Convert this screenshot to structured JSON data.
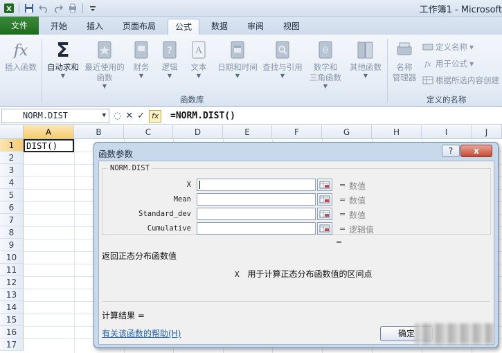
{
  "window": {
    "title": "工作簿1 - Microsoft"
  },
  "ribbon_tabs": [
    {
      "label": "文件"
    },
    {
      "label": "开始"
    },
    {
      "label": "插入"
    },
    {
      "label": "页面布局"
    },
    {
      "label": "公式"
    },
    {
      "label": "数据"
    },
    {
      "label": "审阅"
    },
    {
      "label": "视图"
    }
  ],
  "active_tab": "公式",
  "ribbon": {
    "insert_function": "插入函数",
    "autosum": "自动求和",
    "recently_used": [
      "最近使用的",
      "函数"
    ],
    "financial": "财务",
    "logical": "逻辑",
    "text": "文本",
    "datetime": "日期和时间",
    "lookup": "查找与引用",
    "math": [
      "数学和",
      "三角函数"
    ],
    "more_functions": "其他函数",
    "group_function_library": "函数库",
    "name_manager": [
      "名称",
      "管理器"
    ],
    "define_name": "定义名称",
    "use_in_formula": "用于公式",
    "create_from_selection": "根据所选内容创建",
    "group_defined_names": "定义的名称"
  },
  "formula_bar": {
    "name_box": "NORM.DIST",
    "formula": "=NORM.DIST()"
  },
  "sheet": {
    "columns": [
      "A",
      "B",
      "C",
      "D",
      "E",
      "F",
      "G",
      "H",
      "I",
      "J"
    ],
    "rows": [
      "1",
      "2",
      "3",
      "4",
      "5",
      "6",
      "7",
      "8",
      "9",
      "10",
      "11",
      "12",
      "13",
      "14",
      "15",
      "16",
      "17"
    ],
    "cell_A1": "DIST()"
  },
  "dialog": {
    "title": "函数参数",
    "help_button": "?",
    "close_button": "x",
    "function_name": "NORM.DIST",
    "args": [
      {
        "label": "X",
        "hint": "数值"
      },
      {
        "label": "Mean",
        "hint": "数值"
      },
      {
        "label": "Standard_dev",
        "hint": "数值"
      },
      {
        "label": "Cumulative",
        "hint": "逻辑值"
      }
    ],
    "equals": "=",
    "description": "返回正态分布函数值",
    "arg_name": "X",
    "arg_description": "用于计算正态分布函数值的区间点",
    "result_label": "计算结果 =",
    "help_link": "有关该函数的帮助(H)",
    "ok_button": "确定"
  }
}
